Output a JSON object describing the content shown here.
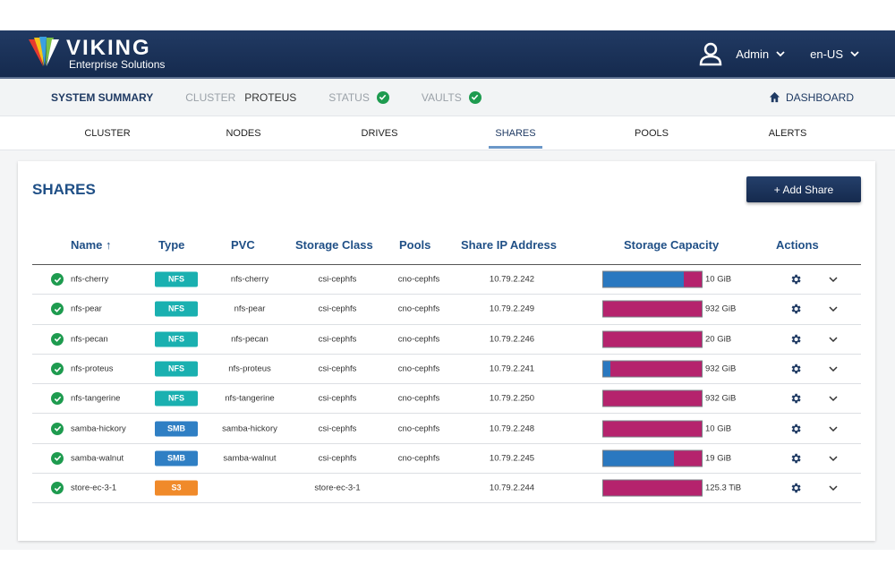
{
  "header": {
    "brand": "VIKING",
    "brand_sub": "Enterprise Solutions",
    "user_label": "Admin",
    "language": "en-US"
  },
  "summary": {
    "title": "SYSTEM SUMMARY",
    "cluster_label": "CLUSTER",
    "cluster_value": "PROTEUS",
    "status_label": "STATUS",
    "vaults_label": "VAULTS",
    "dashboard_label": "DASHBOARD"
  },
  "nav": {
    "tabs": [
      {
        "label": "CLUSTER"
      },
      {
        "label": "NODES"
      },
      {
        "label": "DRIVES"
      },
      {
        "label": "SHARES"
      },
      {
        "label": "POOLS"
      },
      {
        "label": "ALERTS"
      }
    ],
    "active_tab": "SHARES"
  },
  "shares": {
    "title": "SHARES",
    "add_button": "+ Add Share",
    "columns": [
      "Name ↑",
      "Type",
      "PVC",
      "Storage Class",
      "Pools",
      "Share IP Address",
      "Storage Capacity",
      "Actions"
    ],
    "rows": [
      {
        "name": "nfs-cherry",
        "type": "NFS",
        "pvc": "nfs-cherry",
        "storage_class": "csi-cephfs",
        "pool": "cno-cephfs",
        "ip": "10.79.2.242",
        "used_fraction": 0.82,
        "capacity": "10 GiB"
      },
      {
        "name": "nfs-pear",
        "type": "NFS",
        "pvc": "nfs-pear",
        "storage_class": "csi-cephfs",
        "pool": "cno-cephfs",
        "ip": "10.79.2.249",
        "used_fraction": 0.0,
        "capacity": "932 GiB"
      },
      {
        "name": "nfs-pecan",
        "type": "NFS",
        "pvc": "nfs-pecan",
        "storage_class": "csi-cephfs",
        "pool": "cno-cephfs",
        "ip": "10.79.2.246",
        "used_fraction": 0.0,
        "capacity": "20 GiB"
      },
      {
        "name": "nfs-proteus",
        "type": "NFS",
        "pvc": "nfs-proteus",
        "storage_class": "csi-cephfs",
        "pool": "cno-cephfs",
        "ip": "10.79.2.241",
        "used_fraction": 0.07,
        "capacity": "932 GiB"
      },
      {
        "name": "nfs-tangerine",
        "type": "NFS",
        "pvc": "nfs-tangerine",
        "storage_class": "csi-cephfs",
        "pool": "cno-cephfs",
        "ip": "10.79.2.250",
        "used_fraction": 0.0,
        "capacity": "932 GiB"
      },
      {
        "name": "samba-hickory",
        "type": "SMB",
        "pvc": "samba-hickory",
        "storage_class": "csi-cephfs",
        "pool": "cno-cephfs",
        "ip": "10.79.2.248",
        "used_fraction": 0.0,
        "capacity": "10 GiB"
      },
      {
        "name": "samba-walnut",
        "type": "SMB",
        "pvc": "samba-walnut",
        "storage_class": "csi-cephfs",
        "pool": "cno-cephfs",
        "ip": "10.79.2.245",
        "used_fraction": 0.72,
        "capacity": "19 GiB"
      },
      {
        "name": "store-ec-3-1",
        "type": "S3",
        "pvc": "",
        "storage_class": "store-ec-3-1",
        "pool": "",
        "ip": "10.79.2.244",
        "used_fraction": 0.0,
        "capacity": "125.3 TiB"
      }
    ]
  },
  "colors": {
    "header_bg": "#1a3158",
    "accent": "#1f4f86",
    "ok_green": "#1e9b4f",
    "nfs_badge": "#1ab0b0",
    "smb_badge": "#2f7fc4",
    "s3_badge": "#f08a2a",
    "used": "#2a78c0",
    "free": "#b5236d"
  },
  "icons": {
    "logo": "viking-feather-logo",
    "user": "user-icon",
    "dashboard": "home-icon",
    "status_ok": "check-circle-icon",
    "actions": "gear-icon",
    "expand": "chevron-down-icon"
  }
}
